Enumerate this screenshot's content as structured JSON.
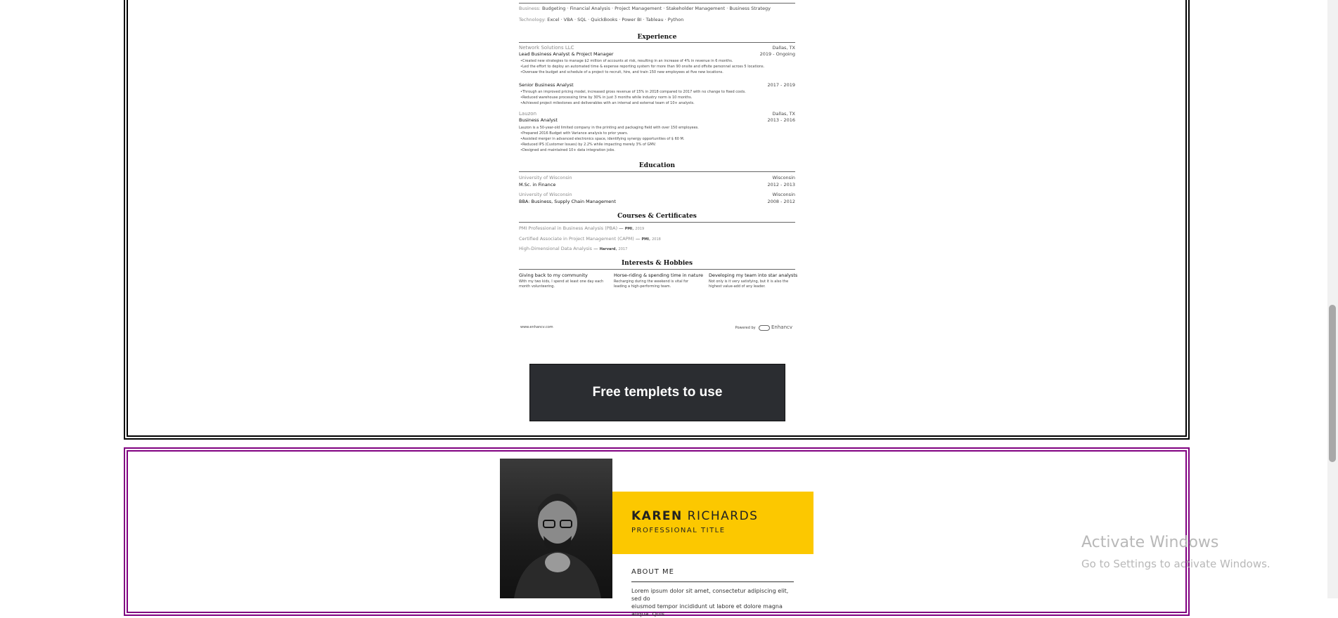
{
  "resume": {
    "skills": {
      "business_label": "Business:",
      "business": "Budgeting · Financial Analysis · Project Management · Stakeholder Management · Business Strategy",
      "technology_label": "Technology:",
      "technology": "Excel · VBA · SQL · QuickBooks · Power BI · Tableau · Python"
    },
    "experience": {
      "title": "Experience",
      "jobs": [
        {
          "company": "Network Solutions LLC",
          "location": "Dallas, TX",
          "role": "Lead Business Analyst & Project Manager",
          "dates": "2019 - Ongoing",
          "bullets": [
            "Created new strategies to manage $2 million of accounts at risk, resulting in an increase of 4% in revenue in 6 months.",
            "Led the effort to deploy an automated time & expense reporting system for more than 90 onsite and offsite personnel across 5 locations.",
            "Oversaw the budget and schedule of a project to recruit, hire, and train 150 new employees at five new locations."
          ]
        },
        {
          "company": "",
          "location": "",
          "role": "Senior Business Analyst",
          "dates": "2017 - 2019",
          "bullets": [
            "Through an improved pricing model, increased gross revenue of 15% in 2018 compared to 2017 with no change to fixed costs.",
            "Reduced warehouse processing time by 30% in just 3 months while industry norm is 10 months.",
            "Achieved project milestones and deliverables with an internal and external team of 10+ analysts."
          ]
        },
        {
          "company": "Lauzon",
          "location": "Dallas, TX",
          "role": "Business Analyst",
          "dates": "2013 - 2016",
          "intro": "Lauzon is a 50-year-old limited company in the printing and packaging field with over 150 employees.",
          "bullets": [
            "Prepared 2016 Budget with Variance analysis to prior years.",
            "Assisted merger in advanced electronics space, identifying synergy opportunities of $ 60 M.",
            "Reduced IPS (Customer Issues) by 2.2% while impacting merely 3% of GMV.",
            "Designed and maintained 10+ data integration jobs."
          ]
        }
      ]
    },
    "education": {
      "title": "Education",
      "items": [
        {
          "school": "University of Wisconsin",
          "location": "Wisconsin",
          "degree": "M.Sc. in Finance",
          "dates": "2012 - 2013"
        },
        {
          "school": "University of Wisconsin",
          "location": "Wisconsin",
          "degree": "BBA: Business, Supply Chain Management",
          "dates": "2008 - 2012"
        }
      ]
    },
    "courses": {
      "title": "Courses & Certificates",
      "items": [
        {
          "name": "PMI Professional in Business Analysis (PBA)",
          "issuer": "PMI",
          "year": "2019"
        },
        {
          "name": "Certified Associate in Project Management (CAPM)",
          "issuer": "PMI",
          "year": "2018"
        },
        {
          "name": "High-Dimensional Data Analysis",
          "issuer": "Harvard",
          "year": "2017"
        }
      ]
    },
    "interests": {
      "title": "Interests & Hobbies",
      "items": [
        {
          "title": "Giving back to my community",
          "desc1": "With my two kids, I spend at least one day each",
          "desc2": "month volunteering."
        },
        {
          "title": "Horse-riding & spending time in nature",
          "desc1": "Recharging during the weekend is vital for",
          "desc2": "leading a high-performing team."
        },
        {
          "title": "Developing my team into star analysts",
          "desc1": "Not only is it very satisfying, but it is also the",
          "desc2": "highest value-add of any leader."
        }
      ]
    },
    "footer": {
      "site": "www.enhancv.com",
      "powered_by": "Powered by",
      "brand": "Enhancv"
    }
  },
  "cta": {
    "label": "Free templets to use"
  },
  "template2": {
    "first_name": "KAREN",
    "last_name": "RICHARDS",
    "title": "PROFESSIONAL TITLE",
    "about_heading": "ABOUT ME",
    "about_line1": "Lorem ipsum dolor sit amet, consectetur adipiscing elit, sed do",
    "about_line2": "eiusmod tempor incididunt ut labore et dolore magna aliqua. Quis"
  },
  "watermark": {
    "line1": "Activate Windows",
    "line2": "Go to Settings to activate Windows."
  },
  "colors": {
    "frame1": "#000000",
    "frame2": "#800080",
    "accent": "#fcc800",
    "button": "#2b2d31"
  }
}
